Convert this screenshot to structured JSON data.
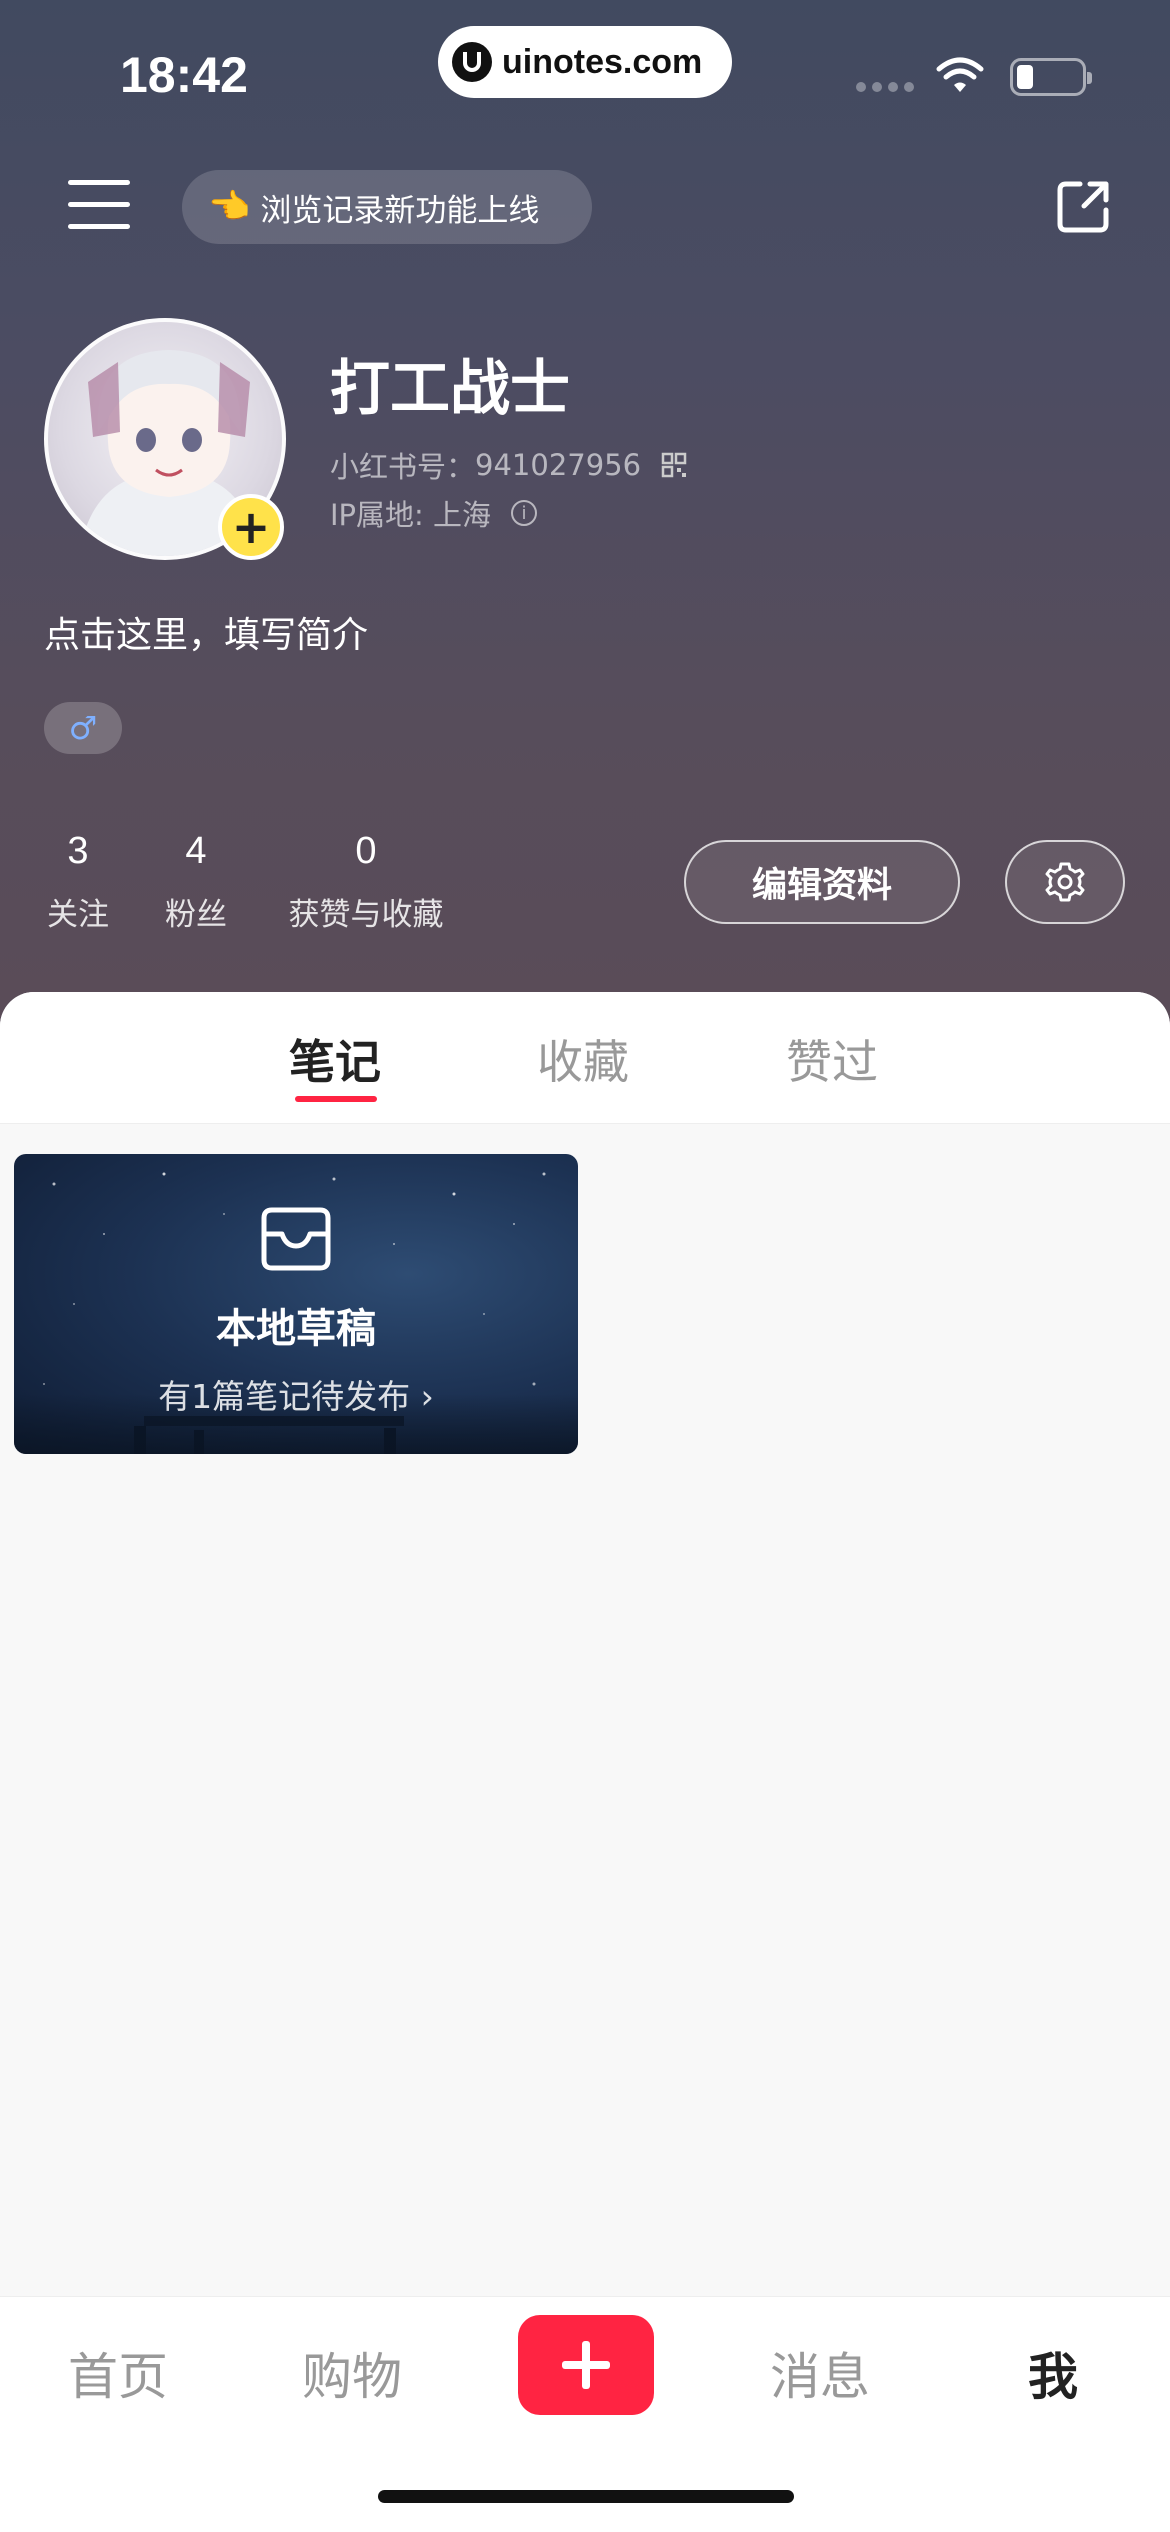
{
  "status_bar": {
    "time": "18:42",
    "watermark": "uinotes.com"
  },
  "top_bar": {
    "notice_emoji": "👈",
    "notice_text": "浏览记录新功能上线"
  },
  "profile": {
    "username": "打工战士",
    "red_id_label": "小红书号：",
    "red_id_value": "941027956",
    "ip_label": "IP属地: 上海",
    "bio": "点击这里，填写简介",
    "gender_symbol": "♂"
  },
  "stats": [
    {
      "num": "3",
      "label": "关注"
    },
    {
      "num": "4",
      "label": "粉丝"
    },
    {
      "num": "0",
      "label": "获赞与收藏"
    }
  ],
  "actions": {
    "edit_label": "编辑资料"
  },
  "tabs": [
    {
      "label": "笔记",
      "active": true
    },
    {
      "label": "收藏",
      "active": false
    },
    {
      "label": "赞过",
      "active": false
    }
  ],
  "draft": {
    "title": "本地草稿",
    "subtitle": "有1篇笔记待发布 ›"
  },
  "bottom_nav": [
    {
      "label": "首页"
    },
    {
      "label": "购物"
    },
    {
      "label": "消息"
    },
    {
      "label": "我"
    }
  ],
  "colors": {
    "accent": "#ff2442",
    "avatar_badge": "#ffe24a",
    "gender": "#7fb0ff"
  }
}
